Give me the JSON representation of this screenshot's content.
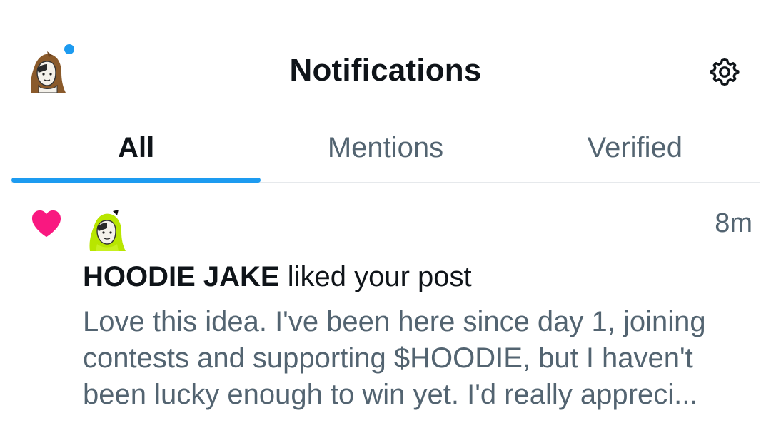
{
  "header": {
    "title": "Notifications",
    "profile_avatar_icon": "hooded-character-avatar",
    "has_unread_dot": true,
    "settings_icon": "gear-icon"
  },
  "tabs": [
    {
      "label": "All",
      "active": true
    },
    {
      "label": "Mentions",
      "active": false
    },
    {
      "label": "Verified",
      "active": false
    }
  ],
  "notifications": [
    {
      "type_icon": "heart-icon",
      "avatar_icon": "green-hoodie-character-avatar",
      "timestamp": "8m",
      "user_name": "HOODIE JAKE",
      "action_text": " liked your post",
      "post_preview": "Love this idea. I've been here since day 1, joining contests and supporting $HOODIE, but I haven't been lucky enough to win yet. I'd really appreci..."
    }
  ],
  "colors": {
    "accent": "#1d9bf0",
    "like": "#f91880",
    "text_primary": "#0f1419",
    "text_secondary": "#536471"
  }
}
